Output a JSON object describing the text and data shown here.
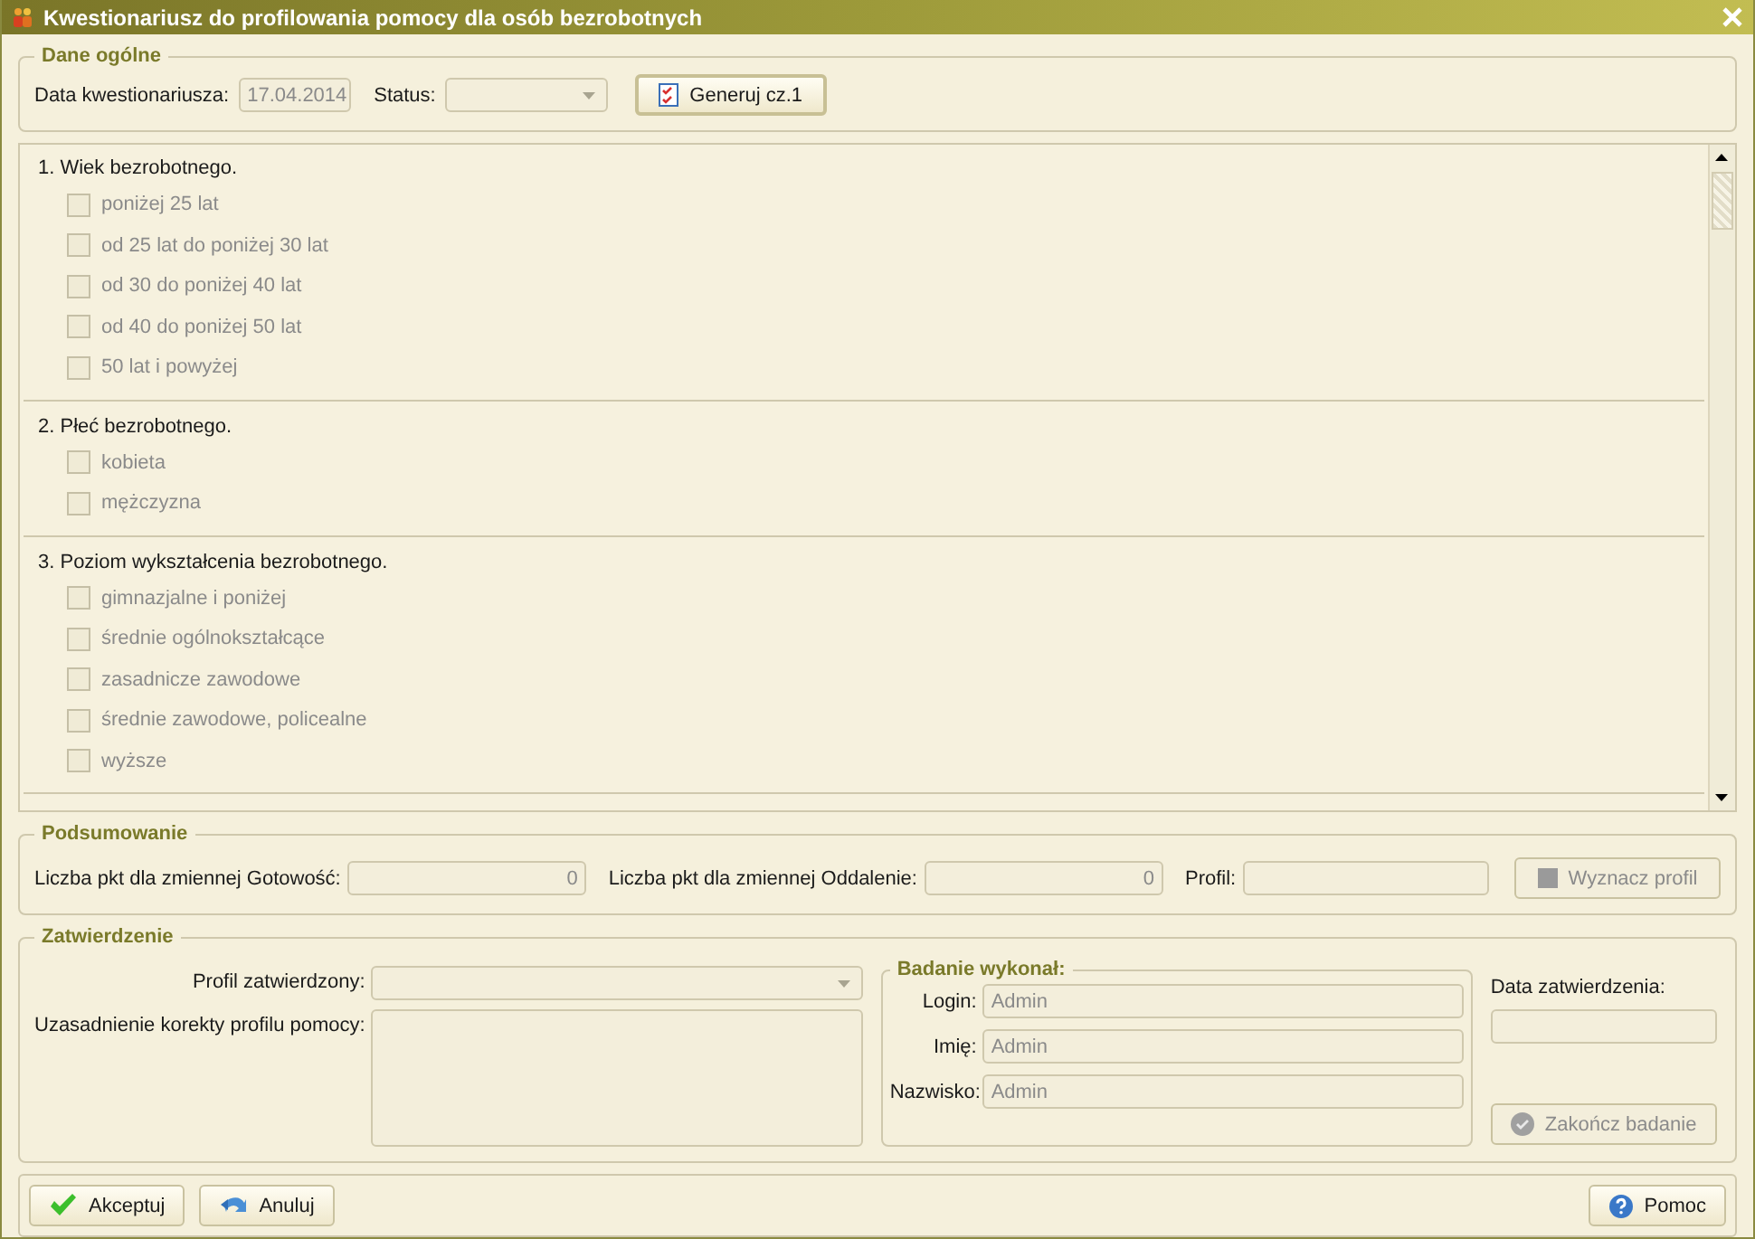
{
  "window": {
    "title": "Kwestionariusz do profilowania pomocy dla osób bezrobotnych"
  },
  "general": {
    "title": "Dane ogólne",
    "date_label": "Data kwestionariusza:",
    "date_value": "17.04.2014",
    "status_label": "Status:",
    "generate_button": "Generuj cz.1"
  },
  "questions": [
    {
      "title": "1.  Wiek bezrobotnego.",
      "options": [
        {
          "label": "poniżej 25 lat",
          "checked": false,
          "disabled": true
        },
        {
          "label": "od 25 lat do poniżej 30 lat",
          "checked": false,
          "disabled": true
        },
        {
          "label": "od 30 do poniżej 40 lat",
          "checked": false,
          "disabled": true
        },
        {
          "label": "od 40 do poniżej 50 lat",
          "checked": false,
          "disabled": true
        },
        {
          "label": "50 lat i powyżej",
          "checked": false,
          "disabled": true
        }
      ]
    },
    {
      "title": "2.  Płeć bezrobotnego.",
      "options": [
        {
          "label": "kobieta",
          "checked": false,
          "disabled": true
        },
        {
          "label": "mężczyzna",
          "checked": false,
          "disabled": true
        }
      ]
    },
    {
      "title": "3.  Poziom wykształcenia bezrobotnego.",
      "options": [
        {
          "label": "gimnazjalne i poniżej",
          "checked": false,
          "disabled": true
        },
        {
          "label": "średnie ogólnokształcące",
          "checked": false,
          "disabled": true
        },
        {
          "label": "zasadnicze zawodowe",
          "checked": false,
          "disabled": true
        },
        {
          "label": "średnie zawodowe, policealne",
          "checked": false,
          "disabled": true
        },
        {
          "label": "wyższe",
          "checked": false,
          "disabled": true
        }
      ]
    }
  ],
  "summary": {
    "title": "Podsumowanie",
    "readiness_label": "Liczba pkt dla zmiennej Gotowość:",
    "readiness_value": "0",
    "distance_label": "Liczba pkt dla zmiennej Oddalenie:",
    "distance_value": "0",
    "profile_label": "Profil:",
    "button": {
      "label": "Wyznacz profil",
      "disabled": true
    }
  },
  "approval": {
    "title": "Zatwierdzenie",
    "profile_label": "Profil zatwierdzony:",
    "justification_label": "Uzasadnienie korekty profilu pomocy:",
    "performer": {
      "title": "Badanie wykonał:",
      "fields": [
        {
          "label": "Login:",
          "value": "Admin"
        },
        {
          "label": "Imię:",
          "value": "Admin"
        },
        {
          "label": "Nazwisko:",
          "value": "Admin"
        }
      ]
    },
    "date_label": "Data zatwierdzenia:",
    "finish_button": {
      "label": "Zakończ badanie",
      "disabled": true
    }
  },
  "footer": {
    "buttons": [
      {
        "label": "Akceptuj",
        "kind": "accept"
      },
      {
        "label": "Anuluj",
        "kind": "cancel"
      },
      {
        "label": "Pomoc",
        "kind": "help"
      }
    ]
  }
}
